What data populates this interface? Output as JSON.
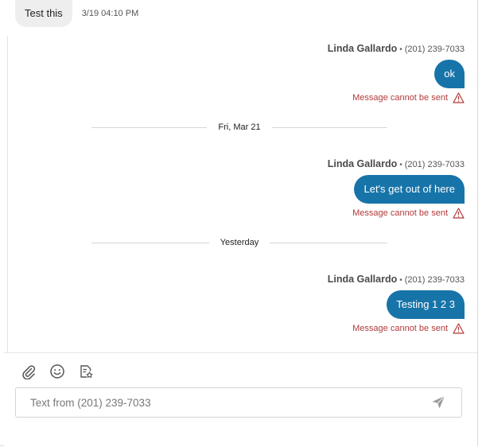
{
  "incoming": {
    "text": "Test this",
    "time": "3/19 04:10 PM"
  },
  "messages": [
    {
      "sender": "Linda Gallardo",
      "separator": "•",
      "phone": "(201) 239-7033",
      "text": "ok",
      "error": "Message cannot be sent"
    },
    {
      "sender": "Linda Gallardo",
      "separator": "•",
      "phone": "(201) 239-7033",
      "text": "Let's get out of here",
      "error": "Message cannot be sent"
    },
    {
      "sender": "Linda Gallardo",
      "separator": "•",
      "phone": "(201) 239-7033",
      "text": "Testing 1 2 3",
      "error": "Message cannot be sent"
    }
  ],
  "date_separators": [
    {
      "label": "Fri, Mar 21"
    },
    {
      "label": "Yesterday"
    }
  ],
  "composer": {
    "placeholder": "Text from (201) 239-7033",
    "tools": [
      "paperclip-icon",
      "emoji-icon",
      "template-icon"
    ],
    "send_icon": "send-icon"
  },
  "colors": {
    "outgoing_bubble": "#1774a9",
    "incoming_bubble": "#eeeeee",
    "error": "#b33a3a"
  }
}
